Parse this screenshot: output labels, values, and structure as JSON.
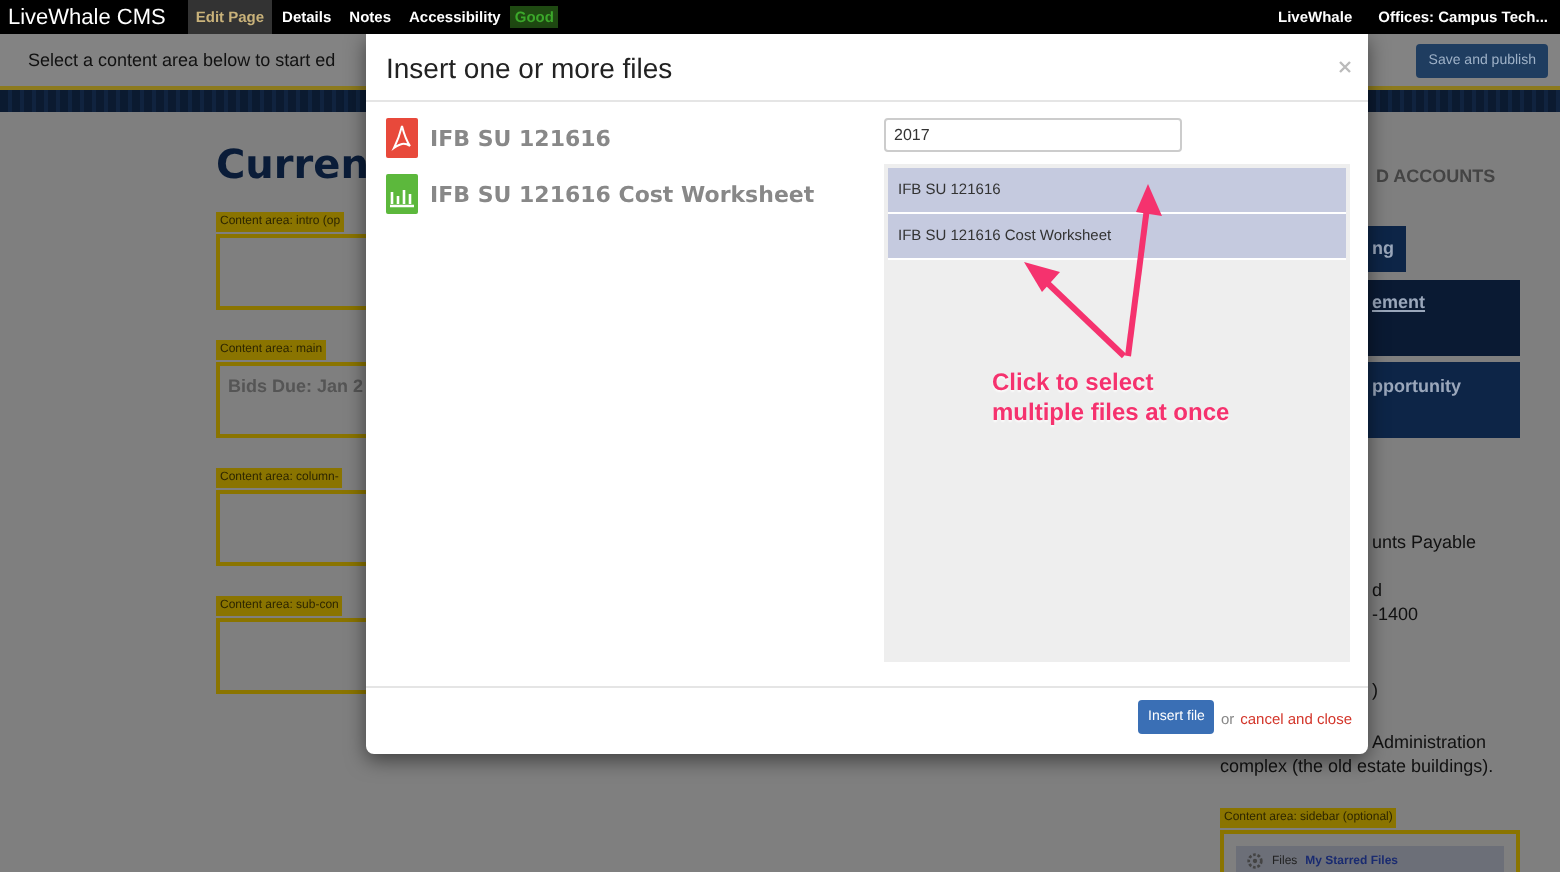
{
  "topbar": {
    "brand": "LiveWhale CMS",
    "tabs": [
      {
        "label": "Edit Page",
        "selected": true
      },
      {
        "label": "Details",
        "selected": false
      },
      {
        "label": "Notes",
        "selected": false
      },
      {
        "label": "Accessibility",
        "selected": false
      }
    ],
    "accessibility_badge": "Good",
    "links": [
      "LiveWhale",
      "Offices: Campus Tech..."
    ]
  },
  "toolbar": {
    "hint": "Select a content area below to start ed",
    "button": "Save and publish"
  },
  "page": {
    "title": "Curren",
    "content_areas": [
      {
        "label": "Content area: intro (op"
      },
      {
        "label": "Content area: main",
        "text": "Bids Due: Jan 2"
      },
      {
        "label": "Content area: column-"
      },
      {
        "label": "Content area: sub-con"
      }
    ]
  },
  "sidebar": {
    "heading": "D ACCOUNTS",
    "buttons": [
      {
        "label": "ng",
        "kind": "tab"
      },
      {
        "label": "ement",
        "kind": "underlined"
      },
      {
        "label": "pportunity",
        "kind": "plain"
      }
    ],
    "paragraphs": [
      [
        "unts Payable"
      ],
      [
        "d",
        "-1400"
      ],
      [
        ")"
      ],
      [
        "Administration",
        "complex (the old estate buildings)."
      ]
    ],
    "area": {
      "label": "Content area: sidebar (optional)",
      "files_label": "Files",
      "files_link": "My Starred Files"
    }
  },
  "modal": {
    "title": "Insert one or more files",
    "files": [
      {
        "name": "IFB SU 121616",
        "kind": "pdf"
      },
      {
        "name": "IFB SU 121616 Cost Worksheet",
        "kind": "spreadsheet"
      }
    ],
    "search": {
      "value": "2017"
    },
    "results": [
      {
        "name": "IFB SU 121616",
        "selected": true
      },
      {
        "name": "IFB SU 121616 Cost Worksheet",
        "selected": true
      }
    ],
    "annotation": [
      "Click to select",
      "multiple files at once"
    ],
    "insert_button": "Insert file",
    "or": "or",
    "cancel": "cancel and close"
  }
}
